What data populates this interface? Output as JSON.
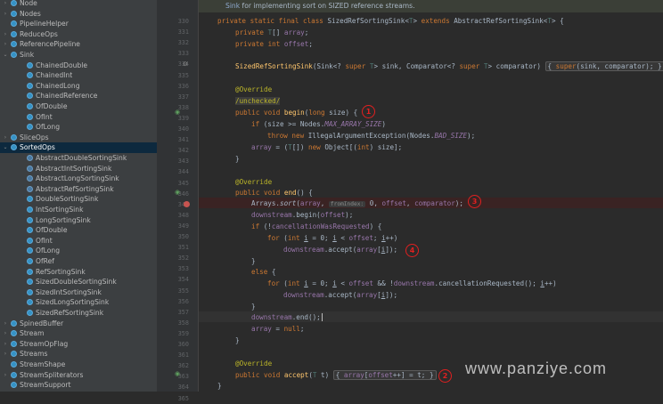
{
  "tree": {
    "items": [
      {
        "label": "Node",
        "depth": 1,
        "arrow": "›",
        "icon": "class",
        "selected": false
      },
      {
        "label": "Nodes",
        "depth": 1,
        "arrow": "›",
        "icon": "class",
        "selected": false
      },
      {
        "label": "PipelineHelper",
        "depth": 1,
        "arrow": "",
        "icon": "class",
        "selected": false
      },
      {
        "label": "ReduceOps",
        "depth": 1,
        "arrow": "›",
        "icon": "class",
        "selected": false
      },
      {
        "label": "ReferencePipeline",
        "depth": 1,
        "arrow": "›",
        "icon": "class",
        "selected": false
      },
      {
        "label": "Sink",
        "depth": 1,
        "arrow": "⌄",
        "icon": "class",
        "selected": false
      },
      {
        "label": "ChainedDouble",
        "depth": 2,
        "arrow": "",
        "icon": "class",
        "selected": false
      },
      {
        "label": "ChainedInt",
        "depth": 2,
        "arrow": "",
        "icon": "class",
        "selected": false
      },
      {
        "label": "ChainedLong",
        "depth": 2,
        "arrow": "",
        "icon": "class",
        "selected": false
      },
      {
        "label": "ChainedReference",
        "depth": 2,
        "arrow": "",
        "icon": "class",
        "selected": false
      },
      {
        "label": "OfDouble",
        "depth": 2,
        "arrow": "",
        "icon": "class",
        "selected": false
      },
      {
        "label": "OfInt",
        "depth": 2,
        "arrow": "",
        "icon": "class",
        "selected": false
      },
      {
        "label": "OfLong",
        "depth": 2,
        "arrow": "",
        "icon": "class",
        "selected": false
      },
      {
        "label": "SliceOps",
        "depth": 1,
        "arrow": "›",
        "icon": "class",
        "selected": false
      },
      {
        "label": "SortedOps",
        "depth": 1,
        "arrow": "⌄",
        "icon": "class",
        "selected": true
      },
      {
        "label": "AbstractDoubleSortingSink",
        "depth": 2,
        "arrow": "",
        "icon": "anon",
        "selected": false
      },
      {
        "label": "AbstractIntSortingSink",
        "depth": 2,
        "arrow": "",
        "icon": "anon",
        "selected": false
      },
      {
        "label": "AbstractLongSortingSink",
        "depth": 2,
        "arrow": "",
        "icon": "anon",
        "selected": false
      },
      {
        "label": "AbstractRefSortingSink",
        "depth": 2,
        "arrow": "",
        "icon": "anon",
        "selected": false
      },
      {
        "label": "DoubleSortingSink",
        "depth": 2,
        "arrow": "",
        "icon": "class",
        "selected": false
      },
      {
        "label": "IntSortingSink",
        "depth": 2,
        "arrow": "",
        "icon": "class",
        "selected": false
      },
      {
        "label": "LongSortingSink",
        "depth": 2,
        "arrow": "",
        "icon": "class",
        "selected": false
      },
      {
        "label": "OfDouble",
        "depth": 2,
        "arrow": "",
        "icon": "class",
        "selected": false
      },
      {
        "label": "OfInt",
        "depth": 2,
        "arrow": "",
        "icon": "class",
        "selected": false
      },
      {
        "label": "OfLong",
        "depth": 2,
        "arrow": "",
        "icon": "class",
        "selected": false
      },
      {
        "label": "OfRef",
        "depth": 2,
        "arrow": "",
        "icon": "class",
        "selected": false
      },
      {
        "label": "RefSortingSink",
        "depth": 2,
        "arrow": "",
        "icon": "class",
        "selected": false
      },
      {
        "label": "SizedDoubleSortingSink",
        "depth": 2,
        "arrow": "",
        "icon": "class",
        "selected": false
      },
      {
        "label": "SizedIntSortingSink",
        "depth": 2,
        "arrow": "",
        "icon": "class",
        "selected": false
      },
      {
        "label": "SizedLongSortingSink",
        "depth": 2,
        "arrow": "",
        "icon": "class",
        "selected": false
      },
      {
        "label": "SizedRefSortingSink",
        "depth": 2,
        "arrow": "",
        "icon": "class",
        "selected": false
      },
      {
        "label": "SpinedBuffer",
        "depth": 1,
        "arrow": "›",
        "icon": "class",
        "selected": false
      },
      {
        "label": "Stream",
        "depth": 1,
        "arrow": "›",
        "icon": "class",
        "selected": false
      },
      {
        "label": "StreamOpFlag",
        "depth": 1,
        "arrow": "›",
        "icon": "class",
        "selected": false
      },
      {
        "label": "Streams",
        "depth": 1,
        "arrow": "›",
        "icon": "class",
        "selected": false
      },
      {
        "label": "StreamShape",
        "depth": 1,
        "arrow": "",
        "icon": "class",
        "selected": false
      },
      {
        "label": "StreamSpliterators",
        "depth": 1,
        "arrow": "›",
        "icon": "class",
        "selected": false
      },
      {
        "label": "StreamSupport",
        "depth": 1,
        "arrow": "",
        "icon": "class",
        "selected": false
      }
    ]
  },
  "editor": {
    "doc_comment": {
      "prefix": "Sink",
      "rest": " for implementing sort on SIZED reference streams."
    },
    "line_numbers": [
      "330",
      "331",
      "332",
      "333",
      "334",
      "335",
      "336",
      "337",
      "338",
      "339",
      "340",
      "341",
      "342",
      "343",
      "344",
      "345",
      "346",
      "347",
      "348",
      "349",
      "350",
      "351",
      "352",
      "353",
      "354",
      "355",
      "356",
      "357",
      "358",
      "359",
      "360",
      "361",
      "362",
      "363",
      "364",
      "365"
    ],
    "lines": {
      "l330_a": "private static final class ",
      "l330_b": "SizedRefSortingSink",
      "l330_c": "<",
      "l330_d": "T",
      "l330_e": "> ",
      "l330_f": "extends ",
      "l330_g": "AbstractRefSortingSink<",
      "l330_h": "T",
      "l330_i": "> {",
      "l331_a": "private ",
      "l331_b": "T",
      "l331_c": "[] ",
      "l331_d": "array",
      "l332_a": "private int ",
      "l332_b": "offset",
      "l334_a": "SizedRefSortingSink",
      "l334_b": "(Sink<? ",
      "l334_c": "super ",
      "l334_d": "T",
      "l334_e": "> sink, Comparator<? ",
      "l334_f": "super ",
      "l334_g": "T",
      "l334_h": "> comparator) ",
      "l334_i": "{ ",
      "l334_j": "super",
      "l334_k": "(sink, comparator); }",
      "l336": "@Override",
      "l337": "/unchecked/",
      "l338_a": "public void ",
      "l338_b": "begin",
      "l338_c": "(",
      "l338_d": "long ",
      "l338_e": "size) {",
      "l339_a": "if ",
      "l339_b": "(size >= Nodes.",
      "l339_c": "MAX_ARRAY_SIZE",
      "l339_d": ")",
      "l340_a": "throw new ",
      "l340_b": "IllegalArgumentException(Nodes.",
      "l340_c": "BAD_SIZE",
      "l340_d": ");",
      "l341_a": "array",
      "l341_b": " = (",
      "l341_c": "T",
      "l341_d": "[]) ",
      "l341_e": "new ",
      "l341_f": "Object[(",
      "l341_g": "int",
      "l341_h": ") size];",
      "l342": "}",
      "l344": "@Override",
      "l345_a": "public void ",
      "l345_b": "end",
      "l345_c": "() {",
      "l346_a": "Arrays.",
      "l346_b": "sort",
      "l346_c": "(",
      "l346_d": "array",
      ",l346_e": ", ",
      "l346_f": "fromIndex:",
      "l346_g": " 0, ",
      "l346_h": "offset",
      ",l346_i": ", ",
      "l346_j": "comparator",
      "l346_k": ");",
      "l347_a": "downstream",
      ".l347_b": ".begin(",
      "l347_c": "offset",
      "l347_d": ");",
      "l348_a": "if ",
      "l348_b": "(!",
      "l348_c": "cancellationWasRequested",
      "l348_d": ") {",
      "l349_a": "for ",
      "l349_b": "(",
      "l349_c": "int ",
      "l349_d": "i",
      " l349_e": " = 0; ",
      "l349_f": "i",
      ".l349_g": " < ",
      "l349_h": "offset",
      "l349_i": "; ",
      "l349_j": "i",
      "l349_k": "++)",
      "l350_a": "downstream",
      "l350_b": ".accept(",
      "l350_c": "array",
      "l350_d": "[",
      "l350_e": "i",
      "l350_f": "]);",
      "l351": "}",
      "l352_a": "else ",
      "l352_b": "{",
      "l353_a": "for ",
      "l353_b": "(",
      "l353_c": "int ",
      "l353_d": "i",
      "l353_e": " = 0; ",
      "l353_f": "i",
      "l353_g": " < ",
      "l353_h": "offset",
      "l353_i": " && !",
      "l353_j": "downstream",
      "l353_k": ".cancellationRequested(); ",
      "l353_l": "i",
      "l353_m": "++)",
      "l354_a": "downstream",
      "l354_b": ".accept(",
      "l354_c": "array",
      "l354_d": "[",
      "l354_e": "i",
      "l354_f": "]);",
      "l355": "}",
      "l356_a": "downstream",
      "l356_b": ".end();",
      "l357_a": "array",
      "l357_b": " = ",
      "l357_c": "null",
      ";l357_d": ";",
      "l358": "}",
      "l360": "@Override",
      "l361_a": "public void ",
      "l361_b": "accept",
      "l361_c": "(",
      "l361_d": "T ",
      "l361_e": "t) ",
      "l361_f": "{ ",
      "l361_g": "array",
      "l361_h": "[",
      "l361_i": "offset",
      "l361_j": "++] = t; ",
      "l361_k": "}",
      "l362": "}"
    }
  },
  "annotations": [
    "1",
    "2",
    "3",
    "4"
  ],
  "watermark": "www.panziye.com",
  "colors": {
    "keyword": "#cc7832",
    "annotation": "#bbb529",
    "field": "#9876aa",
    "method": "#ffc66d",
    "accent_red": "#e02020",
    "selection": "#0d293e"
  }
}
